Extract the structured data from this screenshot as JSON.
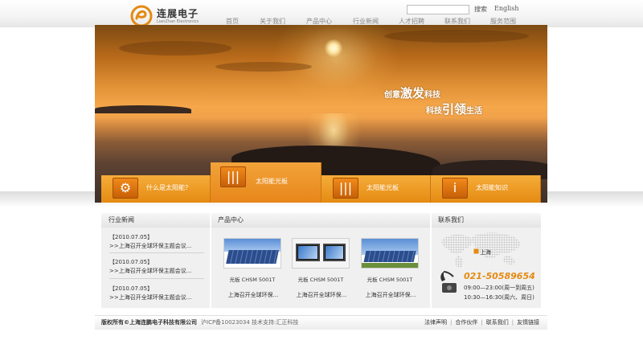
{
  "brand": {
    "name_cn": "连展电子",
    "name_en": "LianZhan Electronics",
    "accent_color": "#e48a12"
  },
  "search": {
    "button_label": "搜索",
    "lang_label": "English"
  },
  "nav": {
    "items": [
      "首页",
      "关于我们",
      "产品中心",
      "行业新闻",
      "人才招聘",
      "联系我们",
      "服务范围"
    ]
  },
  "banner": {
    "slogan_line1": {
      "pre": "创意",
      "big": "激发",
      "post": "科技"
    },
    "slogan_line2": {
      "pre": "科技",
      "big": "引领",
      "post": "生活"
    }
  },
  "feature_tabs": [
    {
      "label": "什么是太阳能？",
      "icon": "gear-icon"
    },
    {
      "label": "太阳能光板",
      "icon": "barcode-icon"
    },
    {
      "label": "太阳能光板",
      "icon": "barcode-icon"
    },
    {
      "label": "太阳能知识",
      "icon": "info-icon"
    }
  ],
  "news": {
    "heading": "行业新闻",
    "items": [
      {
        "date": "【2010.07.05】",
        "title": ">>上海召开全球环保主题会议..."
      },
      {
        "date": "【2010.07.05】",
        "title": ">>上海召开全球环保主题会议..."
      },
      {
        "date": "【2010.07.05】",
        "title": ">>上海召开全球环保主题会议..."
      }
    ]
  },
  "products": {
    "heading": "产品中心",
    "items": [
      {
        "name": "光板 CHSM 5001T",
        "desc": "上海召开全球环保..."
      },
      {
        "name": "光板 CHSM 5001T",
        "desc": "上海召开全球环保..."
      },
      {
        "name": "光板 CHSM 5001T",
        "desc": "上海召开全球环保..."
      }
    ]
  },
  "contact": {
    "heading": "联系我们",
    "city": "上海",
    "phone": "021-50589654",
    "hours_weekday": "09:00—23:00(周一到周五)",
    "hours_weekend": "10:30—16:30(周六、周日)"
  },
  "footer": {
    "copyright": "版权所有©上海连鹏电子科技有限公司",
    "icp": "沪ICP备10023034 技术支持:汇正科技",
    "links": [
      "法律声明",
      "合作伙伴",
      "联系我们",
      "友情链接"
    ]
  }
}
